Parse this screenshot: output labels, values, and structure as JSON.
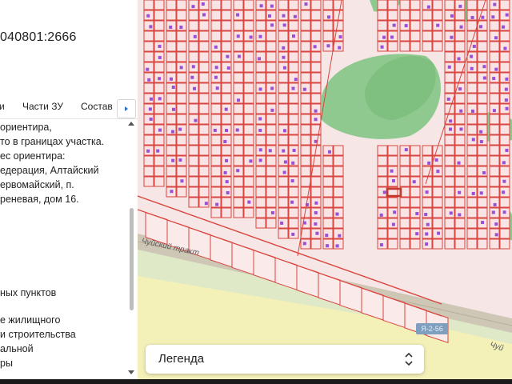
{
  "panel": {
    "cadastral_number": "040801:2666",
    "tabs": [
      {
        "label": "и"
      },
      {
        "label": "Части ЗУ"
      },
      {
        "label": "Состав"
      }
    ],
    "info_lines": [
      "ориентира,",
      "то в границах участка.",
      "ес ориентира:",
      "едерация, Алтайский",
      "ервомайский, п.",
      "реневая, дом 16.",
      "ных пунктов",
      "е жилищного",
      "и строительства",
      "альной",
      "ры"
    ]
  },
  "map": {
    "road_label": "Чуйский тракт",
    "road_badge": "Я-2-56",
    "road_label_right": "Чуй",
    "colors": {
      "parcel_line": "#d9453f",
      "parcel_fill": "#f8e4e4",
      "building": "#9a4fd6",
      "forest": "#8fc98f",
      "field": "#f3f0b8",
      "road": "#d9d0c0",
      "highlight": "#c0392b"
    }
  },
  "legend": {
    "label": "Легенда",
    "icon": "chevron-up-down-icon"
  }
}
